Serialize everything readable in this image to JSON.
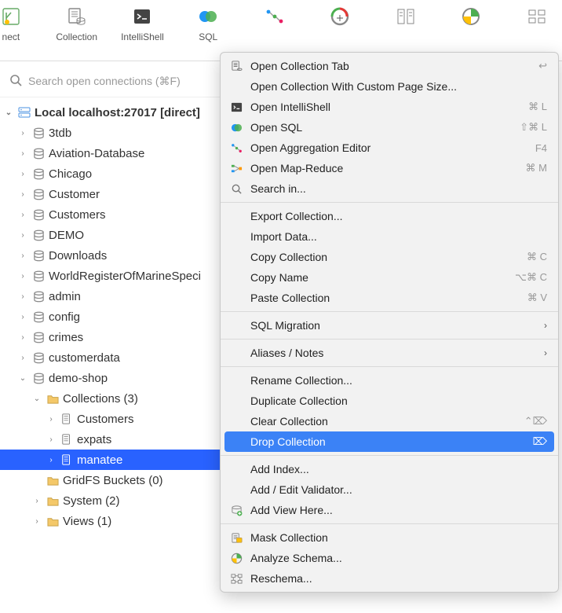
{
  "toolbar": [
    {
      "label": "nect",
      "icon": "connect"
    },
    {
      "label": "Collection",
      "icon": "collection"
    },
    {
      "label": "IntelliShell",
      "icon": "intellishell"
    },
    {
      "label": "SQL",
      "icon": "sql"
    },
    {
      "label": "",
      "icon": "aggregation"
    },
    {
      "label": "",
      "icon": "profile"
    },
    {
      "label": "",
      "icon": "compare"
    },
    {
      "label": "",
      "icon": "schema"
    },
    {
      "label": "",
      "icon": "reschema"
    }
  ],
  "search": {
    "placeholder": "Search open connections (⌘F)"
  },
  "connection": {
    "label": "Local localhost:27017 [direct]"
  },
  "databases": [
    {
      "name": "3tdb"
    },
    {
      "name": "Aviation-Database"
    },
    {
      "name": "Chicago"
    },
    {
      "name": "Customer"
    },
    {
      "name": "Customers"
    },
    {
      "name": "DEMO"
    },
    {
      "name": "Downloads"
    },
    {
      "name": "WorldRegisterOfMarineSpecies",
      "trunc": "WorldRegisterOfMarineSpeci"
    },
    {
      "name": "admin"
    },
    {
      "name": "config"
    },
    {
      "name": "crimes"
    },
    {
      "name": "customerdata"
    }
  ],
  "expandedDb": {
    "name": "demo-shop",
    "collectionsLabel": "Collections (3)",
    "collections": [
      {
        "name": "Customers"
      },
      {
        "name": "expats"
      },
      {
        "name": "manatee",
        "selected": true
      }
    ],
    "gridfs": "GridFS Buckets (0)",
    "system": "System (2)",
    "views": "Views (1)"
  },
  "contextMenu": [
    {
      "type": "item",
      "label": "Open Collection Tab",
      "icon": "collection-doc",
      "shortcut": "↩"
    },
    {
      "type": "item",
      "label": "Open Collection With Custom Page Size..."
    },
    {
      "type": "item",
      "label": "Open IntelliShell",
      "icon": "intellishell",
      "shortcut": "⌘ L"
    },
    {
      "type": "item",
      "label": "Open SQL",
      "icon": "sql",
      "shortcut": "⇧⌘ L"
    },
    {
      "type": "item",
      "label": "Open Aggregation Editor",
      "icon": "aggregation",
      "shortcut": "F4"
    },
    {
      "type": "item",
      "label": "Open Map-Reduce",
      "icon": "mapreduce",
      "shortcut": "⌘ M"
    },
    {
      "type": "item",
      "label": "Search in...",
      "icon": "search"
    },
    {
      "type": "sep"
    },
    {
      "type": "item",
      "label": "Export Collection..."
    },
    {
      "type": "item",
      "label": "Import Data..."
    },
    {
      "type": "item",
      "label": "Copy Collection",
      "shortcut": "⌘ C"
    },
    {
      "type": "item",
      "label": "Copy Name",
      "shortcut": "⌥⌘ C"
    },
    {
      "type": "item",
      "label": "Paste Collection",
      "shortcut": "⌘ V"
    },
    {
      "type": "sep"
    },
    {
      "type": "item",
      "label": "SQL Migration",
      "submenu": true
    },
    {
      "type": "sep"
    },
    {
      "type": "item",
      "label": "Aliases / Notes",
      "submenu": true
    },
    {
      "type": "sep"
    },
    {
      "type": "item",
      "label": "Rename Collection..."
    },
    {
      "type": "item",
      "label": "Duplicate Collection"
    },
    {
      "type": "item",
      "label": "Clear Collection",
      "shortcut": "⌃⌦"
    },
    {
      "type": "item",
      "label": "Drop Collection",
      "highlight": true,
      "shortcut": "⌦"
    },
    {
      "type": "sep"
    },
    {
      "type": "item",
      "label": "Add Index..."
    },
    {
      "type": "item",
      "label": "Add / Edit Validator..."
    },
    {
      "type": "item",
      "label": "Add View Here...",
      "icon": "addview"
    },
    {
      "type": "sep"
    },
    {
      "type": "item",
      "label": "Mask Collection",
      "icon": "mask"
    },
    {
      "type": "item",
      "label": "Analyze Schema...",
      "icon": "schema"
    },
    {
      "type": "item",
      "label": "Reschema...",
      "icon": "reschema"
    }
  ]
}
